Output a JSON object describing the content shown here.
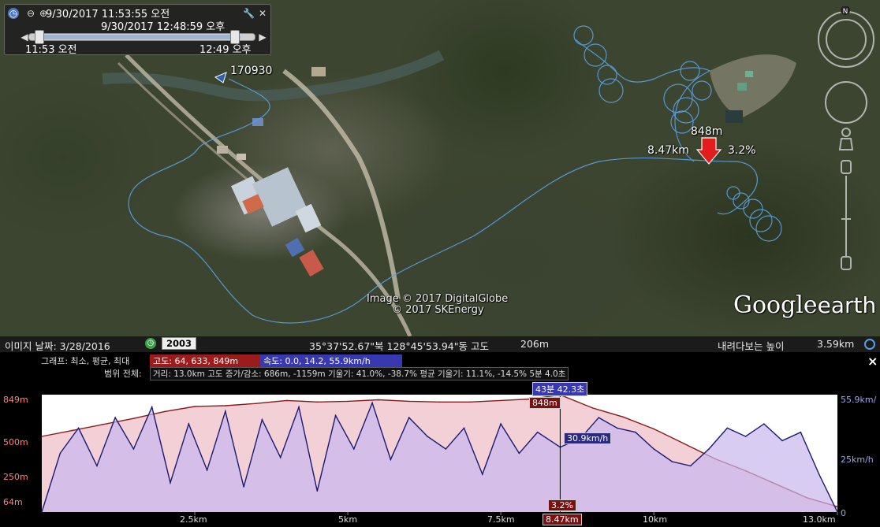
{
  "time_panel": {
    "start_datetime": "9/30/2017  11:53:55 오전",
    "end_datetime": "9/30/2017  12:48:59 오후",
    "range_start": "11:53 오전",
    "range_end": "12:49 오후"
  },
  "map": {
    "track_label": "170930",
    "cursor_elevation": "848m",
    "cursor_distance": "8.47km",
    "cursor_grade": "3.2%",
    "attribution_1": "Image © 2017 DigitalGlobe",
    "attribution_2": "© 2017 SKEnergy",
    "logo_google": "Google",
    "logo_earth": "earth",
    "compass_letter": "N"
  },
  "status_bar": {
    "image_date": "이미지 날짜: 3/28/2016",
    "historical_year": "2003",
    "coordinates": "35°37'52.67\"북 128°45'53.94\"동 고도",
    "altitude": "206m",
    "eye_alt_label": "내려다보는 높이",
    "eye_alt_value": "3.59km"
  },
  "profile": {
    "graph_label": "그래프: 최소, 평균, 최대",
    "elevation_stats": "고도: 64, 633, 849m",
    "speed_stats": "속도: 0.0, 14.2, 55.9km/h",
    "range_label": "범위 전체:",
    "range_stats": "거리: 13.0km 고도 증가/감소: 686m, -1159m 기울기: 41.0%, -38.7% 평균 기울기: 11.1%, -14.5% 5분 4.0초",
    "close_icon": "×",
    "cursor_time": "43분 42.3초",
    "cursor_elevation": "848m",
    "cursor_speed": "30.9km/h",
    "cursor_grade": "3.2%",
    "cursor_distance": "8.47km",
    "left_axis": [
      "849m",
      "500m",
      "250m",
      "64m"
    ],
    "right_axis": [
      "55.9km/",
      "25km/h",
      "0"
    ],
    "x_ticks": [
      "2.5km",
      "5km",
      "7.5km",
      "10km",
      "13.0km"
    ]
  },
  "chart_data": {
    "type": "area",
    "xlabel": "",
    "x_unit": "km",
    "xlim": [
      0,
      13.0
    ],
    "series": [
      {
        "name": "고도",
        "unit": "m",
        "color": "#8b1a1a",
        "ylim": [
          64,
          849
        ],
        "x": [
          0,
          0.5,
          1.0,
          1.5,
          2.0,
          2.5,
          3.0,
          3.5,
          4.0,
          4.5,
          5.0,
          5.5,
          6.0,
          6.5,
          7.0,
          7.5,
          8.0,
          8.47,
          9.0,
          9.5,
          10.0,
          10.5,
          11.0,
          11.5,
          12.0,
          12.5,
          13.0
        ],
        "values": [
          570,
          610,
          650,
          690,
          735,
          770,
          775,
          790,
          810,
          800,
          805,
          815,
          805,
          800,
          800,
          810,
          820,
          848,
          760,
          700,
          620,
          520,
          420,
          340,
          250,
          160,
          100
        ]
      },
      {
        "name": "속도",
        "unit": "km/h",
        "color": "#1a1a70",
        "ylim": [
          0,
          55.9
        ],
        "x": [
          0,
          0.3,
          0.6,
          0.9,
          1.2,
          1.5,
          1.8,
          2.1,
          2.4,
          2.7,
          3.0,
          3.3,
          3.6,
          3.9,
          4.2,
          4.5,
          4.8,
          5.1,
          5.4,
          5.7,
          6.0,
          6.3,
          6.6,
          6.9,
          7.2,
          7.5,
          7.8,
          8.1,
          8.47,
          8.8,
          9.1,
          9.4,
          9.7,
          10.0,
          10.3,
          10.6,
          10.9,
          11.2,
          11.5,
          11.8,
          12.1,
          12.4,
          12.7,
          13.0
        ],
        "values": [
          0,
          28,
          40,
          22,
          45,
          30,
          50,
          14,
          42,
          20,
          48,
          12,
          44,
          26,
          50,
          10,
          46,
          30,
          52,
          25,
          45,
          36,
          30,
          40,
          18,
          42,
          28,
          38,
          30.9,
          35,
          45,
          40,
          38,
          30,
          24,
          22,
          30,
          40,
          36,
          42,
          34,
          38,
          18,
          0
        ]
      }
    ],
    "grid": false
  }
}
